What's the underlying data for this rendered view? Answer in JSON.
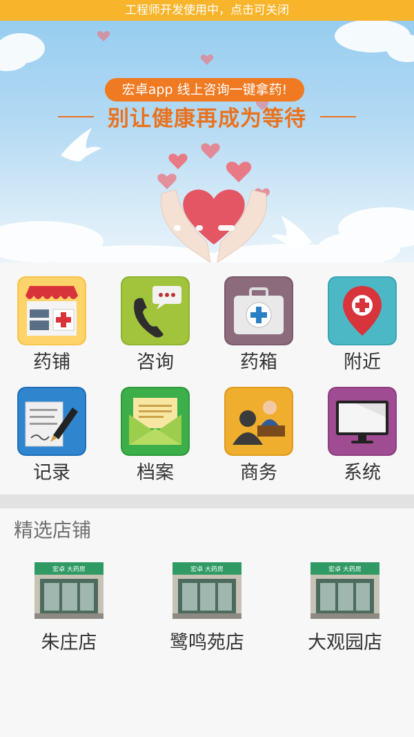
{
  "dev_notice": "工程师开发使用中，点击可关闭",
  "banner": {
    "pill_text": "宏卓app  线上咨询一键拿药!",
    "slogan": "别让健康再成为等待",
    "active_slide": 3,
    "slide_count": 3
  },
  "menu": [
    {
      "label": "药铺",
      "icon": "pharmacy-store-icon"
    },
    {
      "label": "咨询",
      "icon": "phone-chat-icon"
    },
    {
      "label": "药箱",
      "icon": "medicine-kit-icon"
    },
    {
      "label": "附近",
      "icon": "location-pin-icon"
    },
    {
      "label": "记录",
      "icon": "document-pen-icon"
    },
    {
      "label": "档案",
      "icon": "envelope-icon"
    },
    {
      "label": "商务",
      "icon": "business-meeting-icon"
    },
    {
      "label": "系统",
      "icon": "monitor-icon"
    }
  ],
  "featured": {
    "title": "精选店铺",
    "stores": [
      {
        "name": "朱庄店",
        "sign": "宏卓 大药房"
      },
      {
        "name": "鹭鸣苑店",
        "sign": "宏卓 大药房"
      },
      {
        "name": "大观园店",
        "sign": "宏卓 大药房"
      }
    ]
  },
  "colors": {
    "dev_bar": "#f8b42a",
    "accent_orange": "#f07a22",
    "heart_red": "#e05a66"
  }
}
